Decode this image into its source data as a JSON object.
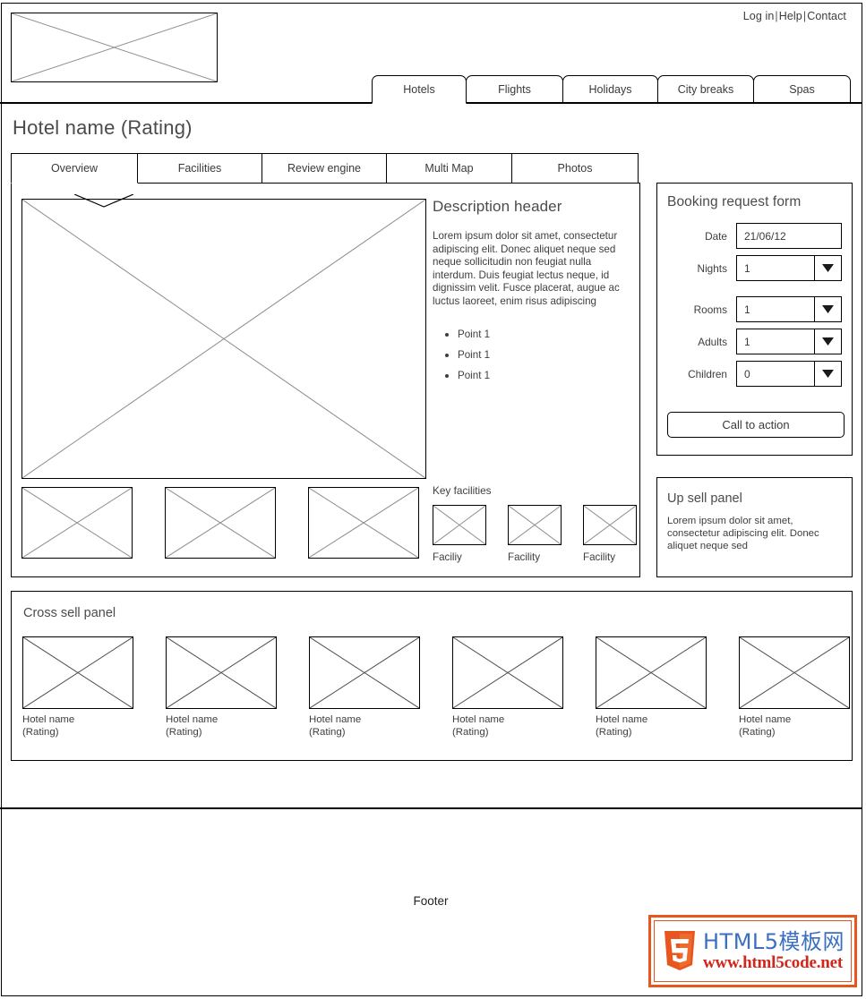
{
  "header": {
    "logo_alt": "logo-placeholder",
    "top_links": [
      "Log in",
      "Help",
      "Contact"
    ],
    "link_separator": "|",
    "nav_tabs": [
      {
        "label": "Hotels",
        "active": true
      },
      {
        "label": "Flights",
        "active": false
      },
      {
        "label": "Holidays",
        "active": false
      },
      {
        "label": "City breaks",
        "active": false
      },
      {
        "label": "Spas",
        "active": false
      }
    ]
  },
  "page_title": "Hotel name (Rating)",
  "content_tabs": [
    {
      "label": "Overview",
      "active": true
    },
    {
      "label": "Facilities",
      "active": false
    },
    {
      "label": "Review engine",
      "active": false
    },
    {
      "label": "Multi Map",
      "active": false
    },
    {
      "label": "Photos",
      "active": false
    }
  ],
  "overview": {
    "hero_alt": "hero-image-placeholder",
    "thumbnails": [
      "thumbnail-1",
      "thumbnail-2",
      "thumbnail-3"
    ],
    "description": {
      "header": "Description header",
      "body": "Lorem ipsum dolor sit amet, consectetur adipiscing elit. Donec aliquet neque sed neque sollicitudin non feugiat nulla interdum. Duis feugiat lectus neque, id dignissim velit. Fusce placerat, augue ac luctus laoreet, enim risus adipiscing",
      "points": [
        "Point 1",
        "Point 1",
        "Point 1"
      ]
    },
    "key_facilities": {
      "title": "Key facilities",
      "items": [
        {
          "label": "Faciliy"
        },
        {
          "label": "Facility"
        },
        {
          "label": "Facility"
        }
      ]
    }
  },
  "booking_form": {
    "title": "Booking request form",
    "fields": [
      {
        "label": "Date",
        "value": "21/06/12",
        "type": "text"
      },
      {
        "label": "Nights",
        "value": "1",
        "type": "select"
      },
      {
        "label": "Rooms",
        "value": "1",
        "type": "select"
      },
      {
        "label": "Adults",
        "value": "1",
        "type": "select"
      },
      {
        "label": "Children",
        "value": "0",
        "type": "select"
      }
    ],
    "cta_label": "Call to action"
  },
  "upsell": {
    "title": "Up sell panel",
    "body": "Lorem ipsum dolor sit amet, consectetur adipiscing elit. Donec aliquet neque sed"
  },
  "cross_sell": {
    "title": "Cross sell panel",
    "items": [
      {
        "name": "Hotel name",
        "rating": "(Rating)"
      },
      {
        "name": "Hotel name",
        "rating": "(Rating)"
      },
      {
        "name": "Hotel name",
        "rating": "(Rating)"
      },
      {
        "name": "Hotel name",
        "rating": "(Rating)"
      },
      {
        "name": "Hotel name",
        "rating": "(Rating)"
      },
      {
        "name": "Hotel name",
        "rating": "(Rating)"
      }
    ]
  },
  "footer": {
    "label": "Footer"
  },
  "watermark": {
    "brand_cn": "HTML5模板网",
    "url": "www.html5code.net",
    "shield_digit": "5",
    "border_color": "#e8561f",
    "text_color_cn": "#3b6fc4",
    "text_color_url": "#d1261b"
  }
}
